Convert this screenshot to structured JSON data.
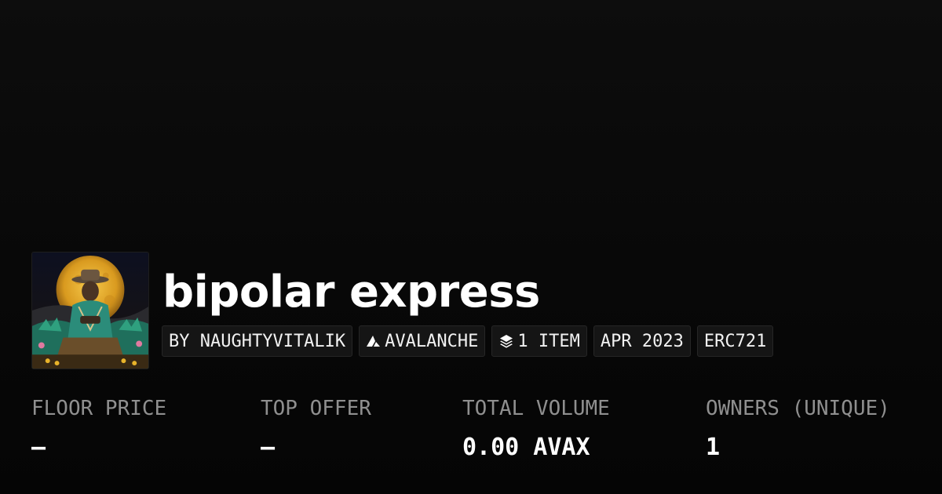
{
  "collection": {
    "title": "bipolar express",
    "thumbnail_icon": "collection-artwork-moon-cowboy"
  },
  "tags": {
    "creator": "BY NAUGHTYVITALIK",
    "chain": "AVALANCHE",
    "chain_icon": "avalanche-logo-icon",
    "items": "1 ITEM",
    "items_icon": "layers-icon",
    "date": "APR 2023",
    "standard": "ERC721"
  },
  "stats": [
    {
      "label": "FLOOR PRICE",
      "value": "—"
    },
    {
      "label": "TOP OFFER",
      "value": "—"
    },
    {
      "label": "TOTAL VOLUME",
      "value": "0.00 AVAX"
    },
    {
      "label": "OWNERS (UNIQUE)",
      "value": "1"
    }
  ],
  "colors": {
    "background": "#0a0a0a",
    "tag_background": "#151515",
    "tag_border": "#262626",
    "label_text": "#8f8f8f",
    "value_text": "#ffffff"
  }
}
